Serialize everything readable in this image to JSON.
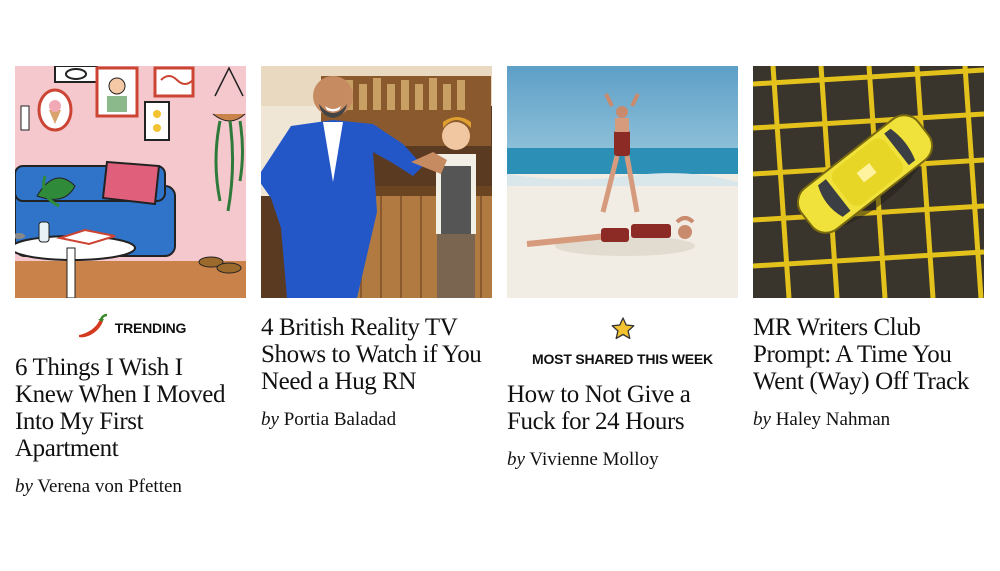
{
  "articles": [
    {
      "badge": "TRENDING",
      "badge_icon": "chili-pepper-icon",
      "title": "6 Things I Wish I Knew When I Moved Into My First Apartment",
      "by": "by",
      "author": "Verena von Pfetten"
    },
    {
      "title": "4 British Reality TV Shows to Watch if You Need a Hug RN",
      "by": "by",
      "author": "Portia Baladad"
    },
    {
      "badge": "MOST SHARED THIS WEEK",
      "badge_icon": "star-icon",
      "title": "How to Not Give a Fuck for 24 Hours",
      "by": "by",
      "author": "Vivienne Molloy"
    },
    {
      "title": "MR Writers Club Prompt: A Time You Went (Way) Off Track",
      "by": "by",
      "author": "Haley Nahman"
    }
  ],
  "colors": {
    "badge_red": "#d33a1f",
    "badge_star": "#f2c230",
    "text": "#111111"
  }
}
